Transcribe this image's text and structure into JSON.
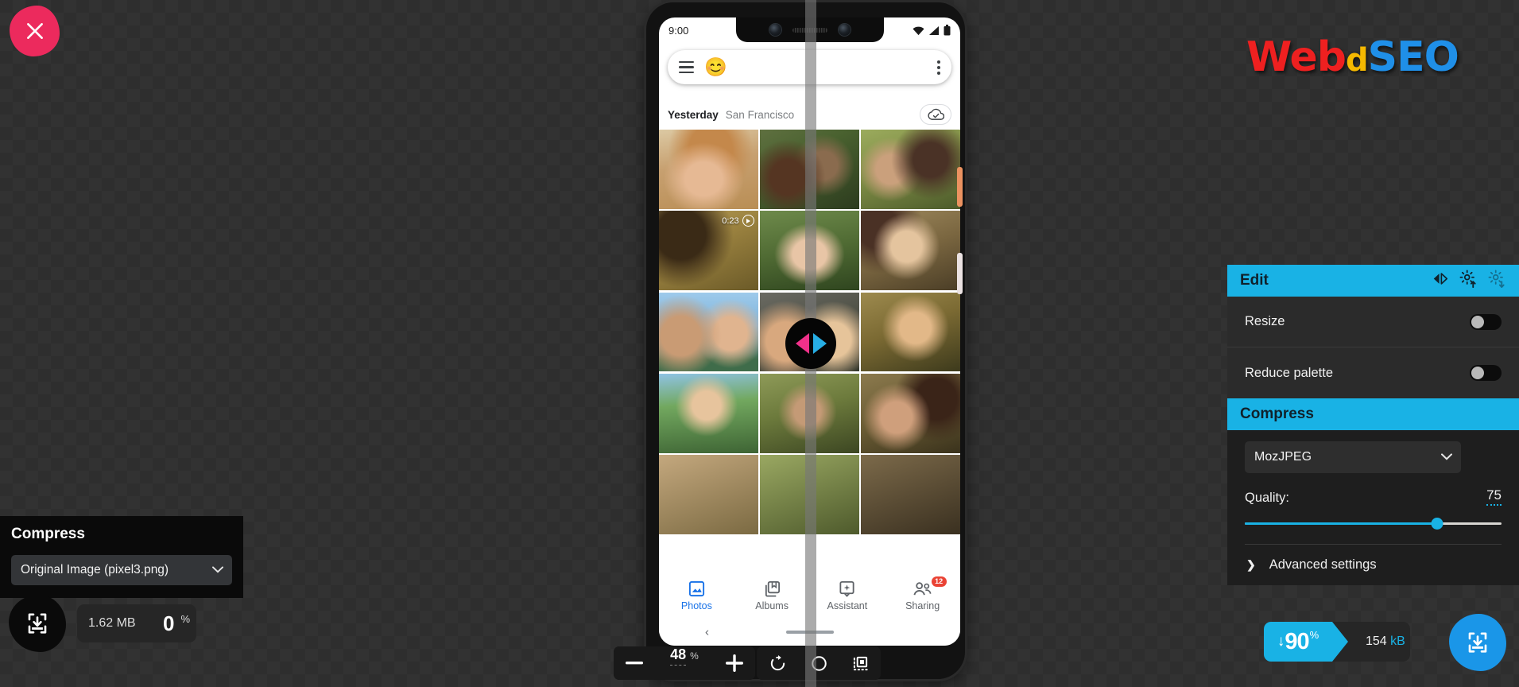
{
  "app": {
    "close_label": "close",
    "logo": {
      "part1": "Web",
      "part2": "d",
      "part3": "SEO"
    }
  },
  "phone": {
    "status": {
      "time": "9:00",
      "wifi": "wifi-icon",
      "signal": "signal-icon",
      "battery": "battery-icon"
    },
    "searchbar": {
      "menu": "hamburger-icon",
      "avatar": "😊",
      "overflow": "kebab-icon"
    },
    "date_row": {
      "day": "Yesterday",
      "place": "San Francisco",
      "cloud": "cloud-done-icon"
    },
    "video_badge": {
      "duration": "0:23"
    },
    "nav": [
      {
        "label": "Photos",
        "icon": "photo-icon",
        "active": true,
        "badge": ""
      },
      {
        "label": "Albums",
        "icon": "albums-icon",
        "active": false,
        "badge": ""
      },
      {
        "label": "Assistant",
        "icon": "assistant-icon",
        "active": false,
        "badge": ""
      },
      {
        "label": "Sharing",
        "icon": "sharing-icon",
        "active": false,
        "badge": "12"
      }
    ],
    "back_glyph": "‹"
  },
  "left_panel": {
    "title": "Compress",
    "select_value": "Original Image (pixel3.png)",
    "download_icon": "download-icon",
    "size": "1.62 MB",
    "percent": "0",
    "percent_unit": "%"
  },
  "zoom_toolbar": {
    "minus": "−",
    "value": "48",
    "unit": "%",
    "plus": "+",
    "rotate_icon": "rotate-icon",
    "background_icon": "circle-icon",
    "fit_icon": "fit-to-frame-icon"
  },
  "right_panel": {
    "edit": {
      "title": "Edit",
      "icons": [
        "swap-arrows-icon",
        "gear-upload-icon",
        "gear-download-icon"
      ],
      "options": [
        {
          "label": "Resize",
          "enabled": false
        },
        {
          "label": "Reduce palette",
          "enabled": false
        }
      ]
    },
    "compress": {
      "title": "Compress",
      "codec": "MozJPEG",
      "quality_label": "Quality:",
      "quality_value": "75",
      "quality_min": 0,
      "quality_max": 100,
      "advanced_label": "Advanced settings",
      "advanced_chevron": "❯"
    }
  },
  "result": {
    "arrow": "↓",
    "percent": "90",
    "percent_unit": "%",
    "size_number": "154",
    "size_unit": "kB",
    "download_icon": "download-icon"
  },
  "colors": {
    "accent": "#19b2e5",
    "close": "#ec2a5d",
    "download": "#1a96e8",
    "logo_red": "#ee2020",
    "logo_yellow": "#f5b800",
    "logo_blue": "#1f8fe8"
  }
}
